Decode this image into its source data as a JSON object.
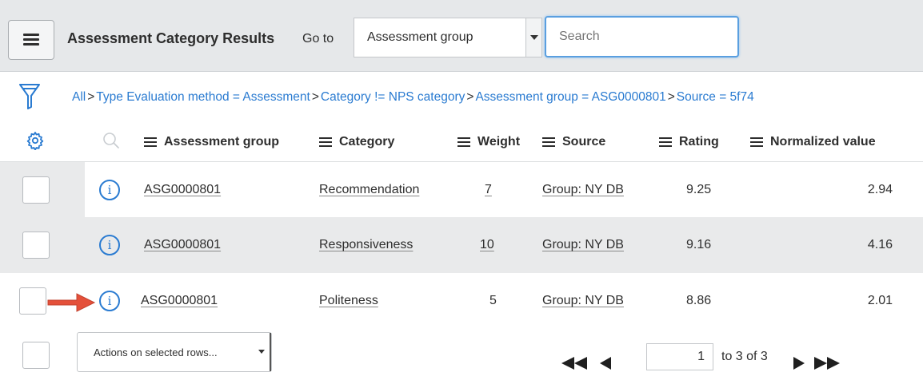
{
  "header": {
    "title": "Assessment Category Results",
    "goto_label": "Go to",
    "goto_select_value": "Assessment group",
    "search_placeholder": "Search"
  },
  "breadcrumb": {
    "items": [
      "All",
      "Type Evaluation method = Assessment",
      "Category != NPS category",
      "Assessment group = ASG0000801",
      "Source = 5f74"
    ],
    "separator": ">"
  },
  "columns": [
    "Assessment group",
    "Category",
    "Weight",
    "Source",
    "Rating",
    "Normalized value"
  ],
  "rows": [
    {
      "assessment_group": "ASG0000801",
      "category": "Recommendation",
      "weight": "7",
      "source": "Group: NY DB",
      "rating": "9.25",
      "normalized_value": "2.94"
    },
    {
      "assessment_group": "ASG0000801",
      "category": "Responsiveness",
      "weight": "10",
      "source": "Group: NY DB",
      "rating": "9.16",
      "normalized_value": "4.16"
    },
    {
      "assessment_group": "ASG0000801",
      "category": "Politeness",
      "weight": "5",
      "source": "Group: NY DB",
      "rating": "8.86",
      "normalized_value": "2.01"
    }
  ],
  "footer": {
    "actions_label": "Actions on selected rows...",
    "page_value": "1",
    "page_range": "to 3 of 3"
  },
  "icons": {
    "menu": "hamburger-icon",
    "filter": "funnel-icon",
    "settings": "gear-icon",
    "search": "magnifier-icon",
    "info": "info-circle-icon",
    "first": "double-left-triangle-icon",
    "prev": "left-triangle-icon",
    "next": "right-triangle-icon",
    "last": "double-right-triangle-icon",
    "callout": "red-arrow-icon"
  },
  "colors": {
    "link_blue": "#2a7bd1",
    "header_bg": "#e6e8ea",
    "alt_row_bg": "#e9eaeb",
    "callout_red": "#e4503a"
  }
}
